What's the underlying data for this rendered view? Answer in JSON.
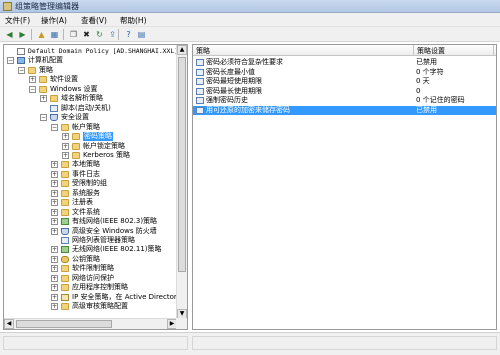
{
  "window": {
    "title": "组策略管理编辑器"
  },
  "menu": [
    "文件(F)",
    "操作(A)",
    "查看(V)",
    "帮助(H)"
  ],
  "toolbar": [
    {
      "icon": "back-arrow-icon",
      "glyph": "◀",
      "color": "#2f7d32"
    },
    {
      "icon": "forward-arrow-icon",
      "glyph": "▶",
      "color": "#2f7d32"
    },
    {
      "icon": "up-folder-icon",
      "glyph": "▲",
      "color": "#c79a22"
    },
    {
      "icon": "show-hide-tree-icon",
      "glyph": "▦",
      "color": "#3c6fb0"
    },
    {
      "icon": "copy-icon",
      "glyph": "❐",
      "color": "#555555"
    },
    {
      "icon": "delete-icon",
      "glyph": "✖",
      "color": "#222222"
    },
    {
      "icon": "refresh-icon",
      "glyph": "↻",
      "color": "#2f7d32"
    },
    {
      "icon": "export-list-icon",
      "glyph": "⇪",
      "color": "#3c6fb0"
    },
    {
      "icon": "help-icon",
      "glyph": "?",
      "color": "#2b5fb3"
    },
    {
      "icon": "properties-icon",
      "glyph": "▤",
      "color": "#3c6fb0"
    }
  ],
  "tree": [
    {
      "label": "Default Domain Policy [AD.SHANGHAI.XXL] 策略",
      "depth": 0,
      "exp": "",
      "icon": "doc",
      "mono": true
    },
    {
      "label": "计算机配置",
      "depth": 0,
      "exp": "−",
      "icon": "pc"
    },
    {
      "label": "策略",
      "depth": 1,
      "exp": "−",
      "icon": "folder"
    },
    {
      "label": "软件设置",
      "depth": 2,
      "exp": "+",
      "icon": "folder"
    },
    {
      "label": "Windows 设置",
      "depth": 2,
      "exp": "−",
      "icon": "folder"
    },
    {
      "label": "域名解析策略",
      "depth": 3,
      "exp": "+",
      "icon": "folder"
    },
    {
      "label": "脚本(启动/关机)",
      "depth": 3,
      "exp": "",
      "icon": "page"
    },
    {
      "label": "安全设置",
      "depth": 3,
      "exp": "−",
      "icon": "shield"
    },
    {
      "label": "帐户策略",
      "depth": 4,
      "exp": "−",
      "icon": "folder"
    },
    {
      "label": "密码策略",
      "depth": 5,
      "exp": "+",
      "icon": "folder",
      "selected": true
    },
    {
      "label": "帐户锁定策略",
      "depth": 5,
      "exp": "+",
      "icon": "folder"
    },
    {
      "label": "Kerberos 策略",
      "depth": 5,
      "exp": "+",
      "icon": "folder"
    },
    {
      "label": "本地策略",
      "depth": 4,
      "exp": "+",
      "icon": "folder"
    },
    {
      "label": "事件日志",
      "depth": 4,
      "exp": "+",
      "icon": "folder"
    },
    {
      "label": "受限制的组",
      "depth": 4,
      "exp": "+",
      "icon": "folder"
    },
    {
      "label": "系统服务",
      "depth": 4,
      "exp": "+",
      "icon": "folder"
    },
    {
      "label": "注册表",
      "depth": 4,
      "exp": "+",
      "icon": "folder"
    },
    {
      "label": "文件系统",
      "depth": 4,
      "exp": "+",
      "icon": "folder"
    },
    {
      "label": "有线网络(IEEE 802.3)策略",
      "depth": 4,
      "exp": "+",
      "icon": "net"
    },
    {
      "label": "高级安全 Windows 防火墙",
      "depth": 4,
      "exp": "+",
      "icon": "shield"
    },
    {
      "label": "网络列表管理器策略",
      "depth": 4,
      "exp": "",
      "icon": "page"
    },
    {
      "label": "无线网络(IEEE 802.11)策略",
      "depth": 4,
      "exp": "+",
      "icon": "net"
    },
    {
      "label": "公钥策略",
      "depth": 4,
      "exp": "+",
      "icon": "key"
    },
    {
      "label": "软件限制策略",
      "depth": 4,
      "exp": "+",
      "icon": "folder"
    },
    {
      "label": "网络访问保护",
      "depth": 4,
      "exp": "+",
      "icon": "folder"
    },
    {
      "label": "应用程序控制策略",
      "depth": 4,
      "exp": "+",
      "icon": "folder"
    },
    {
      "label": "IP 安全策略，在 Active Directory",
      "depth": 4,
      "exp": "+",
      "icon": "book"
    },
    {
      "label": "高级审核策略配置",
      "depth": 4,
      "exp": "+",
      "icon": "folder"
    }
  ],
  "list": {
    "columns": [
      "策略",
      "策略设置"
    ],
    "rows": [
      {
        "policy": "密码必须符合复杂性要求",
        "setting": "已禁用",
        "selected": false
      },
      {
        "policy": "密码长度最小值",
        "setting": "0 个字符",
        "selected": false
      },
      {
        "policy": "密码最短使用期限",
        "setting": "0 天",
        "selected": false
      },
      {
        "policy": "密码最长使用期限",
        "setting": "0",
        "selected": false
      },
      {
        "policy": "强制密码历史",
        "setting": "0 个记住的密码",
        "selected": false
      },
      {
        "policy": "用可还原的加密来储存密码",
        "setting": "已禁用",
        "selected": true
      }
    ]
  }
}
